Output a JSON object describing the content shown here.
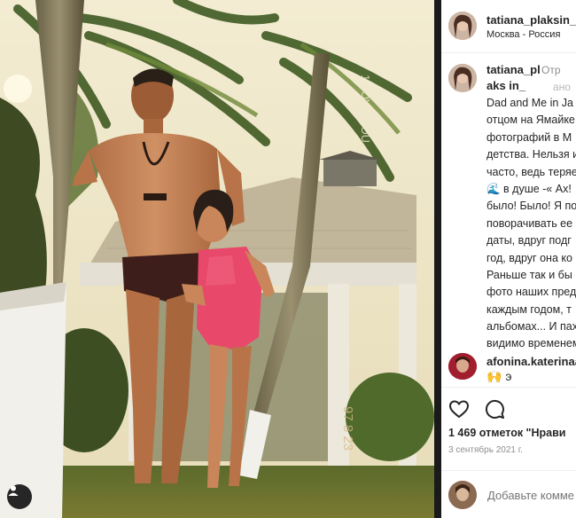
{
  "photo": {
    "alt_visible": "",
    "watermark": "1 LOVE YOU",
    "date_stamp": "97 8 23"
  },
  "header": {
    "username": "tatiana_plaksin_",
    "location": "Москва - Россия"
  },
  "caption": {
    "username": "tatiana_plaks in_",
    "edited_label": "Отр",
    "edited_label2": "ано",
    "lines": [
      "Dad and Me in Ja",
      "отцом на Ямайке",
      "фотографий в М",
      "детства. Нельзя и",
      "часто, ведь теряе",
      "🌊 в душе -« Ах!",
      "было! Было! Я по",
      "поворачивать ее",
      "даты, вдруг подг",
      "год, вдруг она ко",
      "Раньше так и бы",
      "фото наших пред",
      "каждым годом, т",
      "альбомах... И пах",
      "видимо временем"
    ]
  },
  "comment": {
    "username": "afonina.katerinaa",
    "text": "🙌 э"
  },
  "actions": {
    "like_icon": "heart-icon",
    "comment_icon": "comment-bubble-icon"
  },
  "likes_text": "1 469 отметок \"Нрави",
  "date_text": "3 сентябрь 2021 г.",
  "add_comment": {
    "placeholder": "Добавьте комме"
  }
}
